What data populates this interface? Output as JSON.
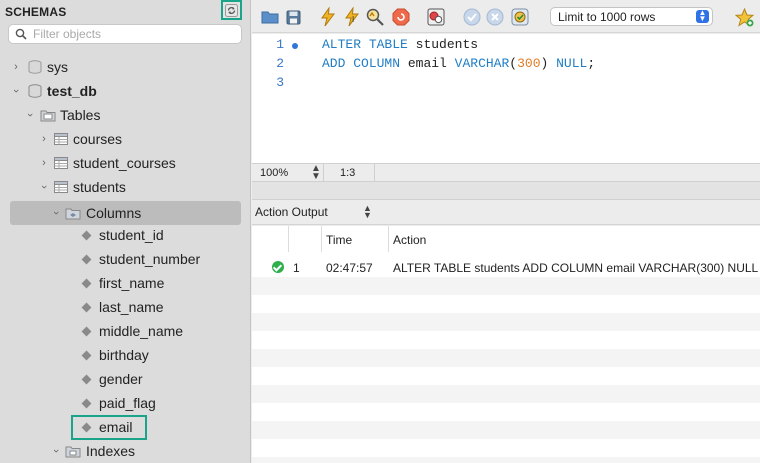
{
  "sidebar": {
    "title": "SCHEMAS",
    "search_placeholder": "Filter objects",
    "tree": {
      "sys": "sys",
      "test_db": "test_db",
      "tables": "Tables",
      "courses": "courses",
      "student_courses": "student_courses",
      "students": "students",
      "columns": "Columns",
      "column_items": [
        "student_id",
        "student_number",
        "first_name",
        "last_name",
        "middle_name",
        "birthday",
        "gender",
        "paid_flag",
        "email"
      ],
      "indexes": "Indexes"
    }
  },
  "toolbar": {
    "limit_value": "Limit to 1000 rows",
    "icons": [
      "open-folder-icon",
      "save-icon",
      "execute-icon",
      "execute-current-icon",
      "explain-icon",
      "stop-icon",
      "toggle-error-icon",
      "commit-icon",
      "rollback-icon",
      "autocommit-icon",
      "beautify-icon"
    ]
  },
  "editor": {
    "line_numbers": [
      "1",
      "2",
      "3"
    ],
    "line1": {
      "kw1": "ALTER",
      "kw2": "TABLE",
      "ident": "students"
    },
    "line2": {
      "kw1": "ADD",
      "kw2": "COLUMN",
      "ident": "email",
      "type": "VARCHAR",
      "open": "(",
      "num": "300",
      "close": ")",
      "kw3": "NULL",
      "end": ";"
    },
    "zoom": "100%",
    "cursor_pos": "1:3"
  },
  "output": {
    "selector": "Action Output",
    "columns": {
      "time": "Time",
      "action": "Action"
    },
    "rows": [
      {
        "index": "1",
        "time": "02:47:57",
        "action": "ALTER TABLE students ADD COLUMN email VARCHAR(300) NULL",
        "status": "success"
      }
    ]
  },
  "colors": {
    "accent_highlight": "#1aa58a",
    "keyword": "#1f7ec6",
    "number": "#e07b24",
    "success": "#2eae4c"
  }
}
